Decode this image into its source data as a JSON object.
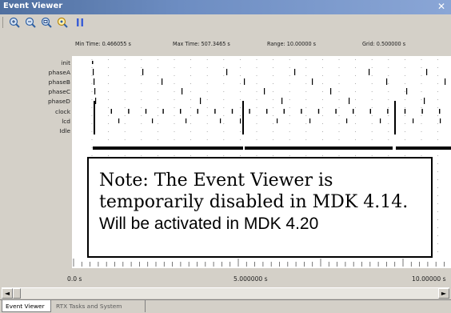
{
  "window": {
    "title": "Event Viewer",
    "close_glyph": "✕"
  },
  "toolbar": {
    "buttons": [
      {
        "name": "zoom-in-icon"
      },
      {
        "name": "zoom-out-icon"
      },
      {
        "name": "zoom-all-icon"
      },
      {
        "name": "zoom-find-icon"
      },
      {
        "name": "pause-icon"
      }
    ]
  },
  "header": {
    "min_time": "Min Time: 0.466055 s",
    "max_time": "Max Time: 507.3465 s",
    "range": "Range: 10.00000 s",
    "grid": "Grid: 0.500000 s"
  },
  "signals": [
    "init",
    "phaseA",
    "phaseB",
    "phaseC",
    "phaseD",
    "clock",
    "lcd",
    "Idle"
  ],
  "axis": {
    "start_label": "0.0 s",
    "mid_label": "5.000000 s",
    "end_label": "10.00000 s"
  },
  "tabs": {
    "event_viewer": "Event Viewer",
    "rtx": "RTX Tasks and System"
  },
  "note": {
    "line1": "Note:  The Event Viewer is",
    "line2": "temporarily disabled in MDK 4.14.",
    "line3": "Will be activated in MDK 4.20"
  },
  "colors": {
    "title_bar": "#6d8dc2",
    "background": "#d4d0c8",
    "plot_background": "#ffffff",
    "event_mark": "#000000"
  },
  "scrollbar": {
    "left_arrow": "◄",
    "right_arrow": "►"
  }
}
